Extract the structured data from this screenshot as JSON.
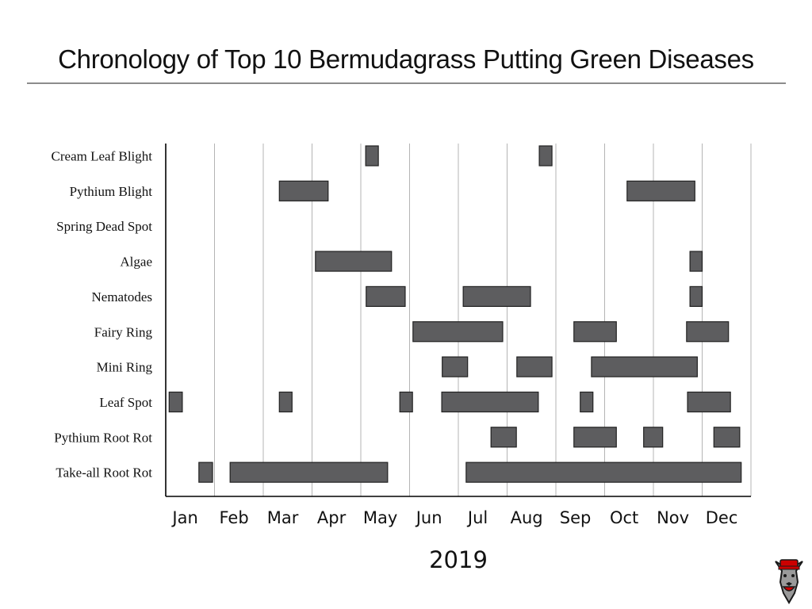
{
  "chart_data": {
    "type": "gantt",
    "title": "Chronology of Top 10 Bermudagrass Putting Green Diseases",
    "xlabel": "2019",
    "ylabel": "",
    "x_unit": "months from Jan 1 (0 = start of Jan, 12 = end of Dec)",
    "xlim": [
      0,
      12
    ],
    "grid": "vertical lines at month boundaries",
    "legend": "none",
    "months": [
      "Jan",
      "Feb",
      "Mar",
      "Apr",
      "May",
      "Jun",
      "Jul",
      "Aug",
      "Sep",
      "Oct",
      "Nov",
      "Dec"
    ],
    "categories": [
      "Cream Leaf Blight",
      "Pythium Blight",
      "Spring Dead Spot",
      "Algae",
      "Nematodes",
      "Fairy Ring",
      "Mini Ring",
      "Leaf Spot",
      "Pythium Root Rot",
      "Take-all Root Rot"
    ],
    "series": [
      {
        "name": "Cream Leaf Blight",
        "intervals": [
          [
            4.1,
            4.36
          ],
          [
            7.66,
            7.92
          ]
        ]
      },
      {
        "name": "Pythium Blight",
        "intervals": [
          [
            2.33,
            3.33
          ],
          [
            9.46,
            10.85
          ]
        ]
      },
      {
        "name": "Spring Dead Spot",
        "intervals": []
      },
      {
        "name": "Algae",
        "intervals": [
          [
            3.07,
            4.63
          ],
          [
            10.75,
            11.0
          ]
        ]
      },
      {
        "name": "Nematodes",
        "intervals": [
          [
            4.11,
            4.91
          ],
          [
            6.1,
            7.48
          ],
          [
            10.75,
            11.0
          ]
        ]
      },
      {
        "name": "Fairy Ring",
        "intervals": [
          [
            5.07,
            6.91
          ],
          [
            8.37,
            9.24
          ],
          [
            10.68,
            11.54
          ]
        ]
      },
      {
        "name": "Mini Ring",
        "intervals": [
          [
            5.67,
            6.19
          ],
          [
            7.2,
            7.92
          ],
          [
            8.73,
            10.9
          ]
        ]
      },
      {
        "name": "Leaf Spot",
        "intervals": [
          [
            0.07,
            0.34
          ],
          [
            2.33,
            2.59
          ],
          [
            4.8,
            5.06
          ],
          [
            5.66,
            7.64
          ],
          [
            8.5,
            8.76
          ],
          [
            10.7,
            11.58
          ]
        ]
      },
      {
        "name": "Pythium Root Rot",
        "intervals": [
          [
            6.67,
            7.19
          ],
          [
            8.37,
            9.24
          ],
          [
            9.8,
            10.19
          ],
          [
            11.24,
            11.77
          ]
        ]
      },
      {
        "name": "Take-all Root Rot",
        "intervals": [
          [
            0.68,
            0.96
          ],
          [
            1.32,
            4.55
          ],
          [
            6.16,
            11.8
          ]
        ]
      }
    ]
  },
  "logo": {
    "name": "NC State wolf mascot",
    "colors": {
      "red": "#cc0000",
      "gray": "#9a9a9a",
      "black": "#1a1a1a"
    }
  }
}
